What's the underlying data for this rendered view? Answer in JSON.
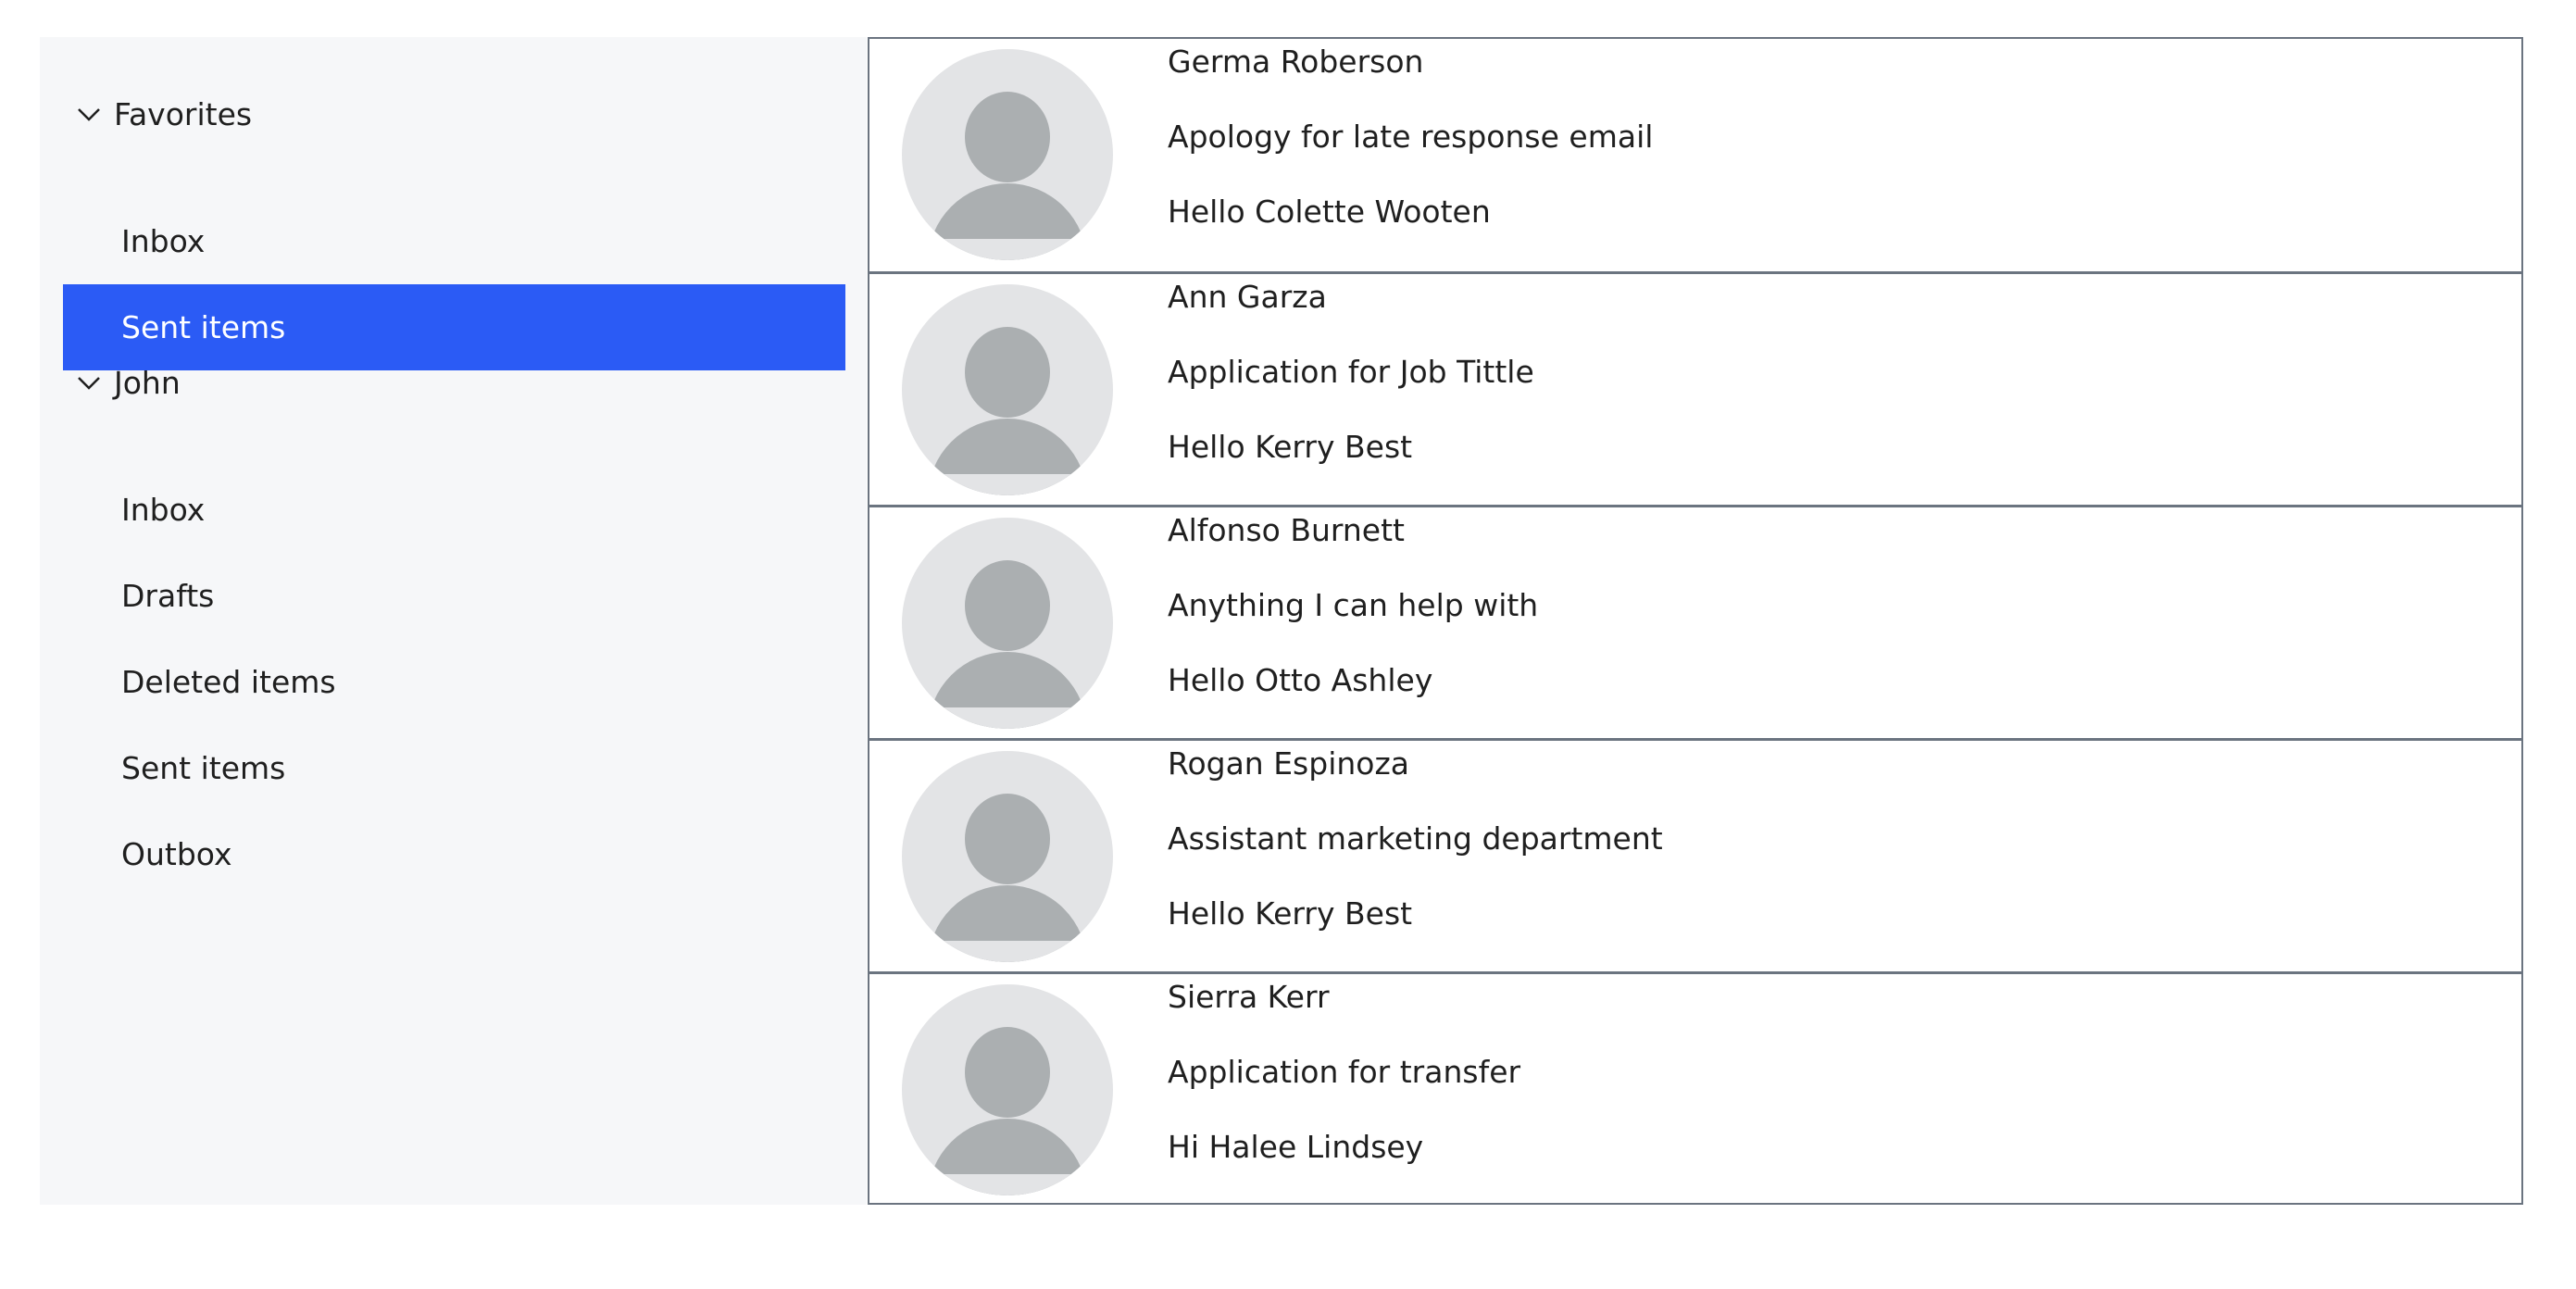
{
  "sidebar": {
    "groups": [
      {
        "label": "Favorites",
        "items": [
          {
            "label": "Inbox",
            "selected": false
          },
          {
            "label": "Sent items",
            "selected": true
          }
        ]
      },
      {
        "label": "John",
        "items": [
          {
            "label": "Inbox",
            "selected": false
          },
          {
            "label": "Drafts",
            "selected": false
          },
          {
            "label": "Deleted items",
            "selected": false
          },
          {
            "label": "Sent items",
            "selected": false
          },
          {
            "label": "Outbox",
            "selected": false
          }
        ]
      }
    ]
  },
  "messages": [
    {
      "sender": "Germa Roberson",
      "subject": "Apology for late response email",
      "preview": "Hello Colette Wooten"
    },
    {
      "sender": "Ann Garza",
      "subject": "Application for Job Tittle",
      "preview": "Hello Kerry Best"
    },
    {
      "sender": "Alfonso Burnett",
      "subject": "Anything I can help with",
      "preview": "Hello Otto Ashley"
    },
    {
      "sender": "Rogan Espinoza",
      "subject": "Assistant marketing department",
      "preview": "Hello Kerry Best"
    },
    {
      "sender": "Sierra Kerr",
      "subject": "Application for transfer",
      "preview": "Hi Halee Lindsey"
    }
  ],
  "colors": {
    "selected_bg": "#2b5bf5",
    "sidebar_bg": "#f6f7f9",
    "avatar_bg": "#e3e4e6",
    "avatar_fg": "#abafb1",
    "row_border": "#6b7480"
  }
}
